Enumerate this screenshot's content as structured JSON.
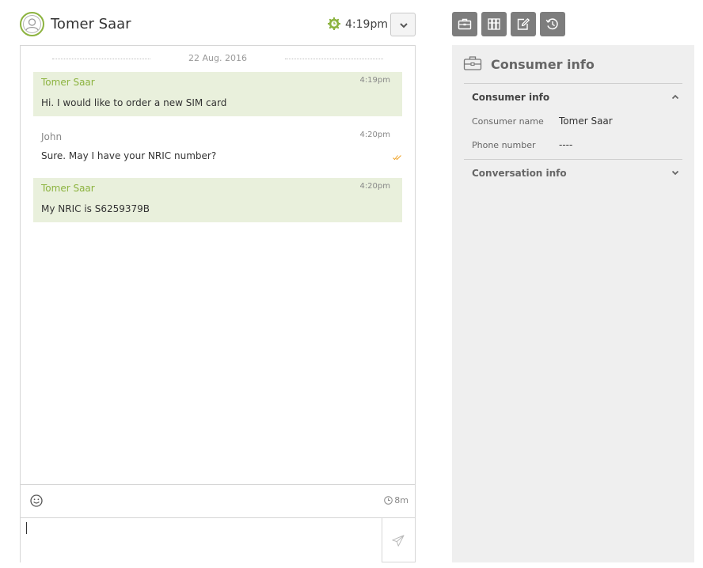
{
  "header": {
    "name": "Tomer Saar",
    "time": "4:19pm"
  },
  "chat": {
    "date": "22 Aug. 2016",
    "messages": [
      {
        "author": "Tomer Saar",
        "time": "4:19pm",
        "text": "Hi. I would like to order a new SIM card",
        "role": "consumer"
      },
      {
        "author": "John",
        "time": "4:20pm",
        "text": "Sure. May I have your NRIC number?",
        "role": "agent"
      },
      {
        "author": "Tomer Saar",
        "time": "4:20pm",
        "text": "My NRIC is S6259379B",
        "role": "consumer"
      }
    ],
    "timer": "8m",
    "input_value": ""
  },
  "toolbar": {
    "buttons": [
      "briefcase-icon",
      "binders-icon",
      "edit-icon",
      "history-icon"
    ]
  },
  "side_panel": {
    "title": "Consumer info",
    "sections": [
      {
        "title": "Consumer info",
        "expanded": true,
        "rows": [
          {
            "label": "Consumer name",
            "value": "Tomer Saar"
          },
          {
            "label": "Phone number",
            "value": "----"
          }
        ]
      },
      {
        "title": "Conversation info",
        "expanded": false
      }
    ]
  },
  "colors": {
    "accent_green": "#8cb33f",
    "consumer_bubble": "#e9f0dc",
    "toolbar_button": "#7d7d7d",
    "side_panel_bg": "#efefef",
    "read_receipt": "#f0a020"
  }
}
